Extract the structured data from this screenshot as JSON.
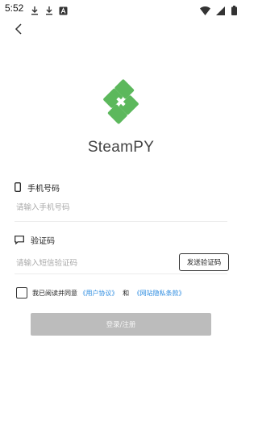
{
  "status_bar": {
    "time": "5:52",
    "icons": [
      "download-icon",
      "download-icon",
      "font-a-icon",
      "wifi-icon",
      "signal-icon",
      "battery-icon"
    ]
  },
  "header": {
    "back_icon": "chevron-left-icon"
  },
  "brand": {
    "app_name": "SteamPY",
    "logo_color": "#5cb85c"
  },
  "phone": {
    "label": "手机号码",
    "placeholder": "请输入手机号码",
    "value": "",
    "icon": "phone-icon"
  },
  "code": {
    "label": "验证码",
    "placeholder": "请输入短信验证码",
    "value": "",
    "icon": "message-icon",
    "send_label": "发送验证码"
  },
  "agreement": {
    "prefix": "我已阅读并同意",
    "user_agreement": "《用户协议》",
    "joiner": "和",
    "privacy": "《网站隐私条款》",
    "link_color": "#2d8ce0",
    "checked": false
  },
  "submit": {
    "label": "登录/注册",
    "enabled": false
  }
}
